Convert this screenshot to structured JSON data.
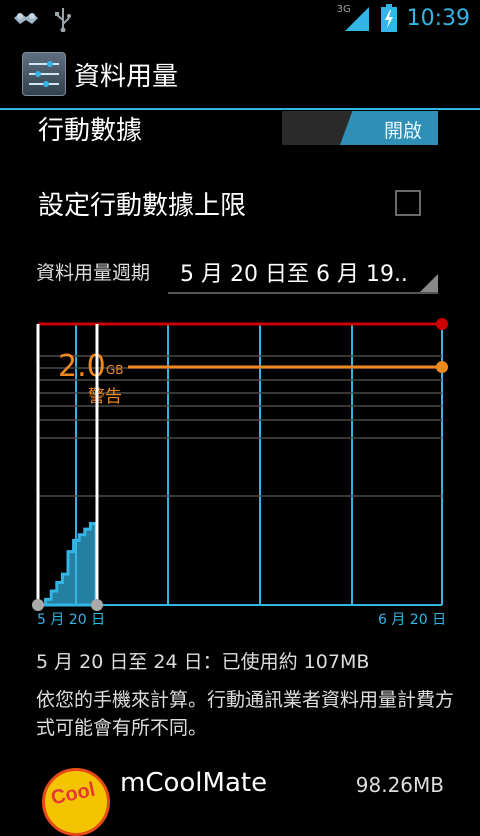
{
  "status_bar": {
    "network_type": "3G",
    "time": "10:39",
    "left_icons": [
      "handshake-icon",
      "usb-icon"
    ],
    "right_icons": [
      "signal-icon",
      "battery-charging-icon"
    ]
  },
  "action_bar": {
    "title": "資料用量",
    "icon": "settings-sliders-icon"
  },
  "mobile_data": {
    "label": "行動數據",
    "switch_label": "開啟",
    "enabled": true
  },
  "limit": {
    "label": "設定行動數據上限",
    "checked": false
  },
  "cycle": {
    "label": "資料用量週期",
    "value": "5 月 20 日至 6 月 19.."
  },
  "chart_data": {
    "type": "area",
    "warning_value": "2.0",
    "warning_unit": "GB",
    "warning_label": "警告",
    "x_start_label": "5 月 20 日",
    "x_end_label": "6 月 20 日",
    "colors": {
      "limit_line": "#cc0000",
      "warning_line": "#f0891e",
      "area": "#33b5e5",
      "grid": "#33b5e5",
      "sweep": "#ffffff"
    },
    "usage_steps_fraction": [
      0.0,
      0.02,
      0.05,
      0.08,
      0.11,
      0.19,
      0.23,
      0.25,
      0.27,
      0.29
    ]
  },
  "summary": "5 月 20 日至 24 日：已使用約 107MB",
  "note": "依您的手機來計算。行動通訊業者資料用量計費方式可能會有所不同。",
  "apps": [
    {
      "name": "mCoolMate",
      "size": "98.26MB",
      "icon_text": "Cool",
      "icon": "mcoolmate-app-icon"
    }
  ]
}
